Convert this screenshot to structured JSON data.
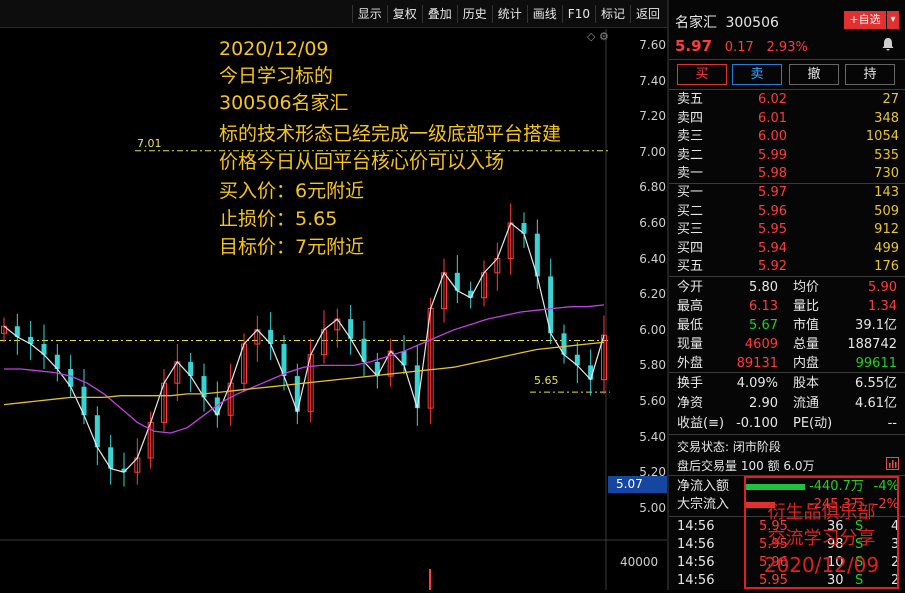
{
  "toolbar": {
    "items": [
      "显示",
      "复权",
      "叠加",
      "历史",
      "统计",
      "画线",
      "F10",
      "标记",
      "返回"
    ]
  },
  "stock": {
    "name": "名家汇",
    "code": "300506",
    "price": "5.97",
    "change": "0.17",
    "change_pct": "2.93%",
    "add_fav": "+自选",
    "dropdown": "▾"
  },
  "trade_buttons": {
    "buy": "买",
    "sell": "卖",
    "cancel": "撤",
    "hold": "持"
  },
  "asks": [
    {
      "label": "卖五",
      "price": "6.02",
      "vol": "27"
    },
    {
      "label": "卖四",
      "price": "6.01",
      "vol": "348"
    },
    {
      "label": "卖三",
      "price": "6.00",
      "vol": "1054"
    },
    {
      "label": "卖二",
      "price": "5.99",
      "vol": "535"
    },
    {
      "label": "卖一",
      "price": "5.98",
      "vol": "730"
    }
  ],
  "bids": [
    {
      "label": "买一",
      "price": "5.97",
      "vol": "143"
    },
    {
      "label": "买二",
      "price": "5.96",
      "vol": "509"
    },
    {
      "label": "买三",
      "price": "5.95",
      "vol": "912"
    },
    {
      "label": "买四",
      "price": "5.94",
      "vol": "499"
    },
    {
      "label": "买五",
      "price": "5.92",
      "vol": "176"
    }
  ],
  "stats1": [
    {
      "l1": "今开",
      "v1": "5.80",
      "c1": "#e6e6e6",
      "l2": "均价",
      "v2": "5.90",
      "c2": "#ff3b3b"
    },
    {
      "l1": "最高",
      "v1": "6.13",
      "c1": "#ff3b3b",
      "l2": "量比",
      "v2": "1.34",
      "c2": "#ff3b3b"
    },
    {
      "l1": "最低",
      "v1": "5.67",
      "c1": "#20d020",
      "l2": "市值",
      "v2": "39.1亿",
      "c2": "#e6e6e6"
    },
    {
      "l1": "现量",
      "v1": "4609",
      "c1": "#ff3b3b",
      "l2": "总量",
      "v2": "188742",
      "c2": "#e6e6e6"
    },
    {
      "l1": "外盘",
      "v1": "89131",
      "c1": "#ff3b3b",
      "l2": "内盘",
      "v2": "99611",
      "c2": "#20d020"
    }
  ],
  "stats2": [
    {
      "l1": "换手",
      "v1": "4.09%",
      "l2": "股本",
      "v2": "6.55亿"
    },
    {
      "l1": "净资",
      "v1": "2.90",
      "l2": "流通",
      "v2": "4.61亿"
    },
    {
      "l1": "收益(≡)",
      "v1": "-0.100",
      "l2": "PE(动)",
      "v2": "--"
    }
  ],
  "status": {
    "label": "交易状态:",
    "value": "闭市阶段",
    "after_label": "盘后交易量",
    "after_vol": "100",
    "after_amt_label": "额",
    "after_amt": "6.0万"
  },
  "flow": [
    {
      "label": "净流入额",
      "value": "-440.7万",
      "pct": "-4%"
    },
    {
      "label": "大宗流入",
      "value": "-245.3万",
      "pct": "-2%"
    }
  ],
  "ticks": [
    {
      "time": "14:56",
      "price": "5.95",
      "vol": "36",
      "side": "S",
      "n": "4"
    },
    {
      "time": "14:56",
      "price": "5.95",
      "vol": "98",
      "side": "S",
      "n": "3"
    },
    {
      "time": "14:56",
      "price": "5.96",
      "vol": "10",
      "side": "S",
      "n": "2"
    },
    {
      "time": "14:56",
      "price": "5.95",
      "vol": "30",
      "side": "S",
      "n": "2"
    }
  ],
  "watermark": [
    "衍生品俱乐部",
    "交流学习分享",
    "2020/12/09"
  ],
  "annotation": [
    "2020/12/09",
    "今日学习标的",
    "300506名家汇",
    "标的技术形态已经完成一级底部平台搭建",
    "价格今日从回平台核心价可以入场",
    "买入价：6元附近",
    "止损价：5.65",
    "目标价：7元附近"
  ],
  "levels": {
    "target": "7.01",
    "stop": "5.65"
  },
  "current_price_tag": "5.07",
  "volume_axis_label": "40000",
  "chart_data": {
    "type": "candlestick",
    "y_ticks": [
      "7.60",
      "7.40",
      "7.20",
      "7.00",
      "6.80",
      "6.60",
      "6.40",
      "6.20",
      "6.00",
      "5.80",
      "5.60",
      "5.40",
      "5.20",
      "5.00"
    ],
    "ylim": [
      5.0,
      7.6
    ],
    "ma_purple": [
      5.78,
      5.78,
      5.77,
      5.76,
      5.74,
      5.7,
      5.64,
      5.56,
      5.48,
      5.43,
      5.42,
      5.45,
      5.52,
      5.59,
      5.64,
      5.68,
      5.72,
      5.76,
      5.79,
      5.8,
      5.8,
      5.8,
      5.82,
      5.85,
      5.88,
      5.92,
      5.96,
      6.0,
      6.03,
      6.06,
      6.08,
      6.1,
      6.11,
      6.12,
      6.13,
      6.13,
      6.14
    ],
    "ma_yellow": [
      5.58,
      5.59,
      5.6,
      5.61,
      5.62,
      5.62,
      5.62,
      5.63,
      5.63,
      5.63,
      5.63,
      5.64,
      5.64,
      5.65,
      5.66,
      5.67,
      5.68,
      5.69,
      5.7,
      5.71,
      5.72,
      5.73,
      5.74,
      5.75,
      5.76,
      5.77,
      5.78,
      5.79,
      5.81,
      5.83,
      5.85,
      5.87,
      5.89,
      5.9,
      5.91,
      5.92,
      5.93
    ],
    "closes": [
      6.02,
      5.96,
      5.92,
      5.86,
      5.78,
      5.68,
      5.52,
      5.34,
      5.22,
      5.2,
      5.28,
      5.48,
      5.7,
      5.82,
      5.74,
      5.62,
      5.52,
      5.7,
      5.92,
      6.0,
      5.92,
      5.74,
      5.54,
      5.86,
      6.0,
      6.06,
      5.95,
      5.82,
      5.74,
      5.88,
      5.8,
      5.56,
      6.12,
      6.32,
      6.22,
      6.18,
      6.32,
      6.4,
      6.6,
      6.54,
      6.3,
      5.98,
      5.86,
      5.8,
      5.72,
      5.97
    ]
  }
}
